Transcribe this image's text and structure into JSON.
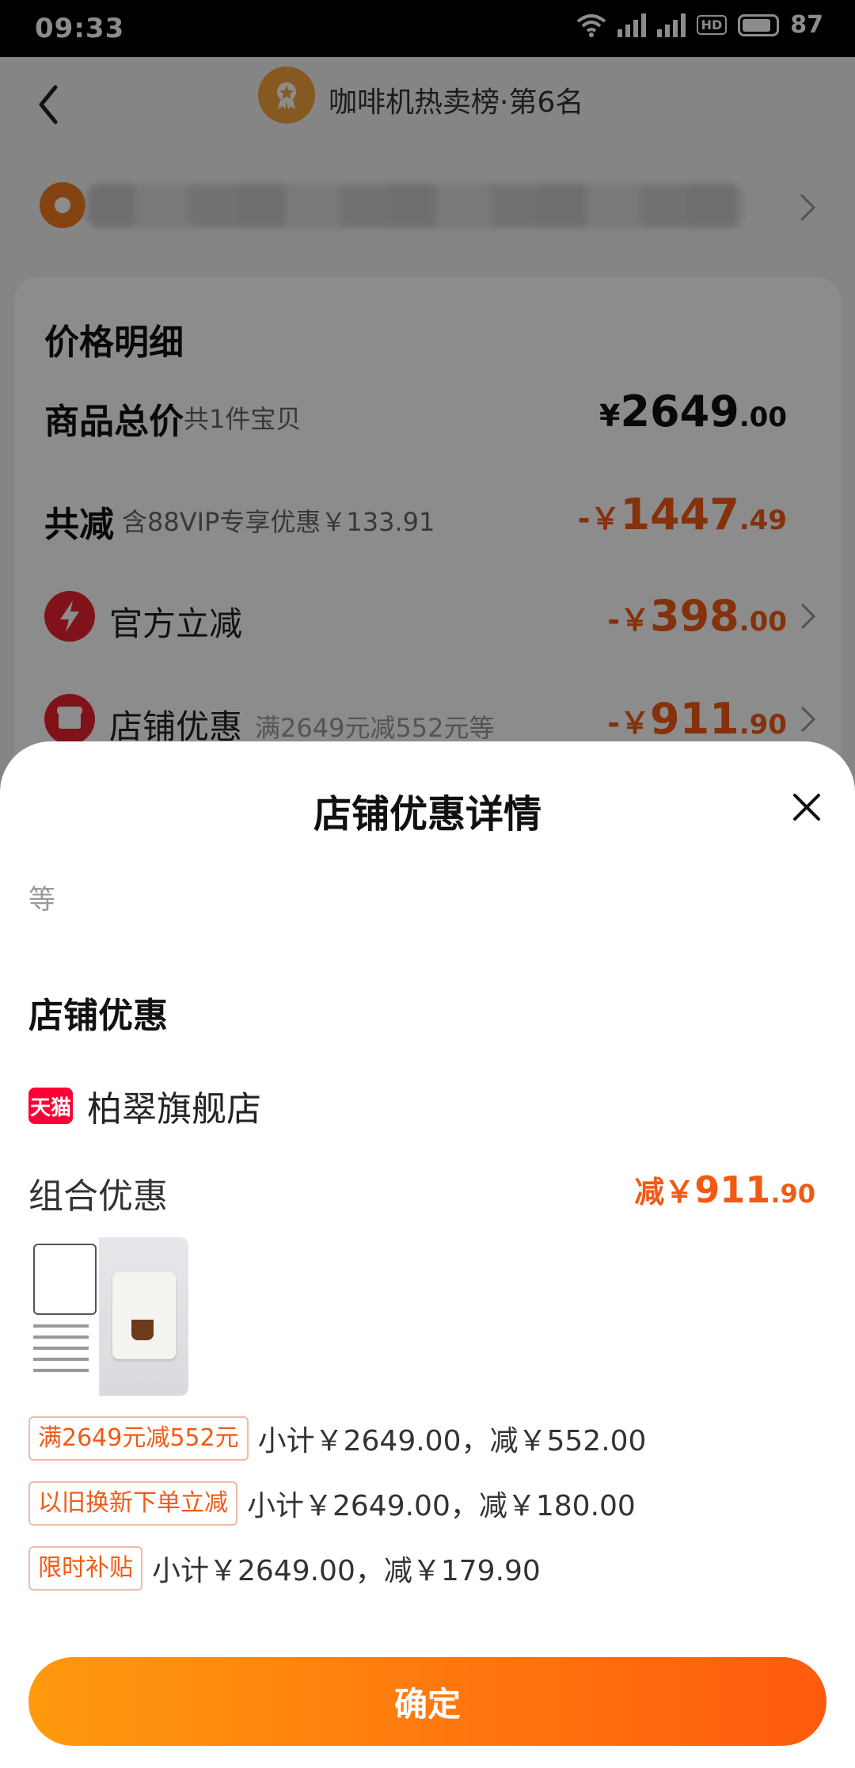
{
  "status_bar": {
    "time": "09:33",
    "battery": "87"
  },
  "nav": {
    "title": "咖啡机热卖榜·第6名"
  },
  "price_card": {
    "title": "价格明细",
    "total": {
      "label": "商品总价",
      "sub": "共1件宝贝",
      "symbol": "¥",
      "int": "2649",
      "dec": ".00"
    },
    "reduce": {
      "label": "共减",
      "sub": "含88VIP专享优惠￥133.91",
      "symbol": "-￥",
      "int": "1447",
      "dec": ".49"
    },
    "official": {
      "label": "官方立减",
      "symbol": "-￥",
      "int": "398",
      "dec": ".00"
    },
    "shop": {
      "label": "店铺优惠",
      "sub": "满2649元减552元等",
      "symbol": "-￥",
      "int": "911",
      "dec": ".90"
    }
  },
  "sheet": {
    "title": "店铺优惠详情",
    "note": "等",
    "section_title": "店铺优惠",
    "shop_badge": "天猫",
    "shop_name": "柏翠旗舰店",
    "combo_label": "组合优惠",
    "combo_amount": {
      "prefix": "减￥",
      "int": "911",
      "dec": ".90"
    },
    "promos": [
      {
        "tag": "满2649元减552元",
        "text": "小计￥2649.00，减￥552.00"
      },
      {
        "tag": "以旧换新下单立减",
        "text": "小计￥2649.00，减￥180.00"
      },
      {
        "tag": "限时补贴",
        "text": "小计￥2649.00，减￥179.90"
      }
    ],
    "confirm_label": "确定"
  }
}
